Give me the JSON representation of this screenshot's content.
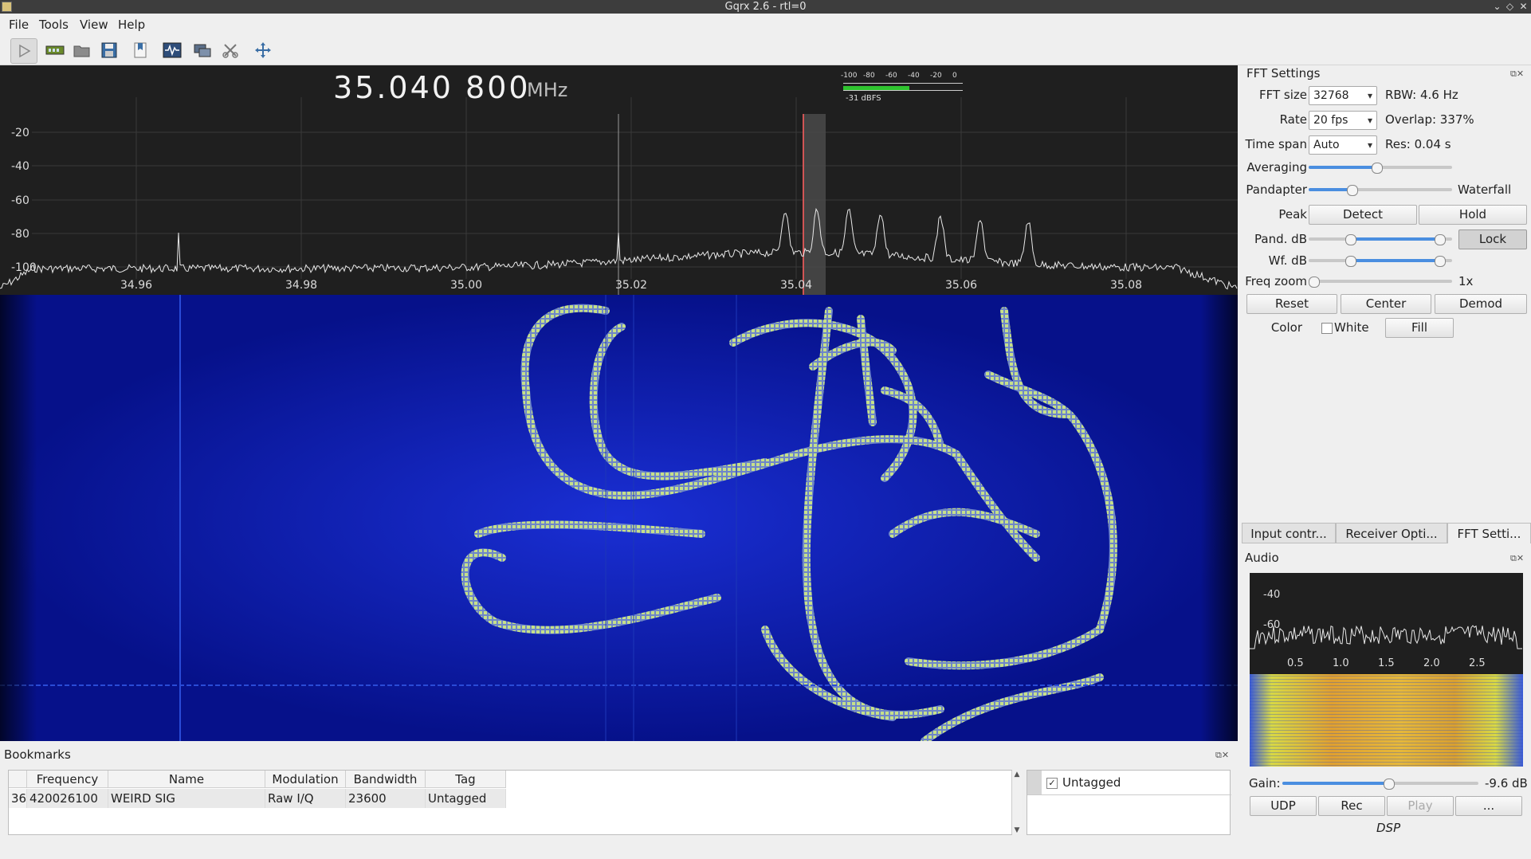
{
  "window": {
    "title": "Gqrx 2.6 - rtl=0"
  },
  "menu": {
    "items": [
      "File",
      "Tools",
      "View",
      "Help"
    ]
  },
  "toolbar": {
    "buttons": [
      "start-dsp",
      "configure-device",
      "open-file",
      "save-file",
      "bookmark",
      "iq-recorder",
      "remote-control",
      "cut",
      "full-screen"
    ]
  },
  "frequency": {
    "value": "35.040 800",
    "unit": "MHz"
  },
  "meter": {
    "scale": [
      "-100",
      "-80",
      "-60",
      "-40",
      "-20",
      "0"
    ],
    "reading": "-31 dBFS",
    "level_fraction": 0.55
  },
  "spectrum": {
    "y_ticks": [
      "-20",
      "-40",
      "-60",
      "-80",
      "-100"
    ],
    "x_ticks": [
      "34.96",
      "34.98",
      "35.00",
      "35.02",
      "35.04",
      "35.06",
      "35.08"
    ]
  },
  "fft": {
    "title": "FFT Settings",
    "fft_size_label": "FFT size",
    "fft_size": "32768",
    "rbw": "RBW: 4.6 Hz",
    "rate_label": "Rate",
    "rate": "20 fps",
    "overlap": "Overlap: 337%",
    "timespan_label": "Time span",
    "timespan": "Auto",
    "res": "Res: 0.04 s",
    "averaging_label": "Averaging",
    "averaging_value": 0.47,
    "pandapter_label": "Pandapter",
    "waterfall_label": "Waterfall",
    "pandapter_value": 0.3,
    "peak_label": "Peak",
    "detect_label": "Detect",
    "hold_label": "Hold",
    "pand_db_label": "Pand. dB",
    "lock_label": "Lock",
    "wf_db_label": "Wf. dB",
    "freq_zoom_label": "Freq zoom",
    "freq_zoom_value": "1x",
    "reset_label": "Reset",
    "center_label": "Center",
    "demod_label": "Demod",
    "color_label": "Color",
    "white_label": "White",
    "fill_label": "Fill"
  },
  "tabs": [
    "Input contr...",
    "Receiver Opti...",
    "FFT Setti..."
  ],
  "audio": {
    "title": "Audio",
    "y_ticks": [
      "-40",
      "-60"
    ],
    "x_ticks": [
      "0.5",
      "1.0",
      "1.5",
      "2.0",
      "2.5"
    ],
    "gain_label": "Gain:",
    "gain_value": "-9.6 dB",
    "gain_fraction": 0.54,
    "udp_label": "UDP",
    "rec_label": "Rec",
    "play_label": "Play",
    "more_label": "...",
    "dsp_label": "DSP"
  },
  "bookmarks": {
    "title": "Bookmarks",
    "columns": [
      "Frequency",
      "Name",
      "Modulation",
      "Bandwidth",
      "Tag"
    ],
    "rows": [
      {
        "index": "36",
        "frequency": "420026100",
        "name": "WEIRD SIG",
        "modulation": "Raw I/Q",
        "bandwidth": "23600",
        "tag": "Untagged"
      }
    ],
    "tags": [
      {
        "label": "Untagged",
        "checked": true
      }
    ]
  }
}
